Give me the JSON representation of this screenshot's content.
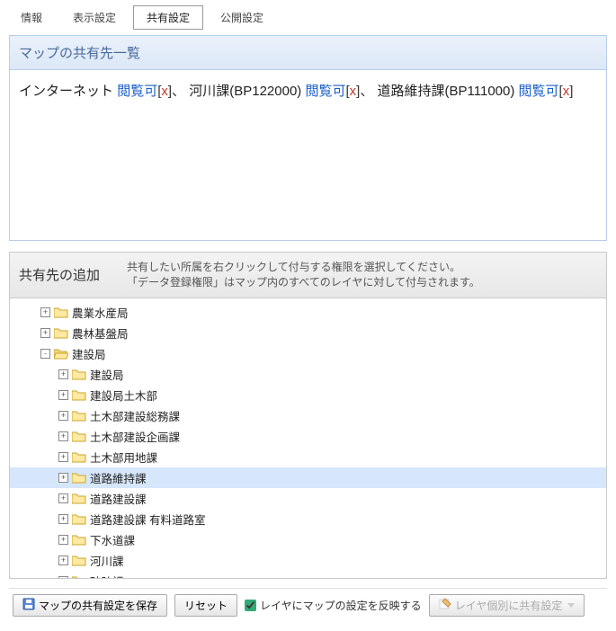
{
  "tabs": [
    {
      "label": "情報"
    },
    {
      "label": "表示設定"
    },
    {
      "label": "共有設定"
    },
    {
      "label": "公開設定"
    }
  ],
  "active_tab": 2,
  "share_list_header": "マップの共有先一覧",
  "shares": [
    {
      "name": "インターネット",
      "perm": "閲覧可",
      "sep": "、"
    },
    {
      "name": "河川課(BP122000)",
      "perm": "閲覧可",
      "sep": "、"
    },
    {
      "name": "道路維持課(BP111000)",
      "perm": "閲覧可",
      "sep": ""
    }
  ],
  "remove_glyph": "x",
  "add_header": "共有先の追加",
  "add_hint_1": "共有したい所属を右クリックして付与する権限を選択してください。",
  "add_hint_2": "「データ登録権限」はマップ内のすべてのレイヤに対して付与されます。",
  "tree": [
    {
      "label": "農業水産局",
      "depth": 1,
      "toggle": "+",
      "open": false,
      "selected": false
    },
    {
      "label": "農林基盤局",
      "depth": 1,
      "toggle": "+",
      "open": false,
      "selected": false
    },
    {
      "label": "建設局",
      "depth": 1,
      "toggle": "-",
      "open": true,
      "selected": false
    },
    {
      "label": "建設局",
      "depth": 2,
      "toggle": "+",
      "open": false,
      "selected": false
    },
    {
      "label": "建設局土木部",
      "depth": 2,
      "toggle": "+",
      "open": false,
      "selected": false
    },
    {
      "label": "土木部建設総務課",
      "depth": 2,
      "toggle": "+",
      "open": false,
      "selected": false
    },
    {
      "label": "土木部建設企画課",
      "depth": 2,
      "toggle": "+",
      "open": false,
      "selected": false
    },
    {
      "label": "土木部用地課",
      "depth": 2,
      "toggle": "+",
      "open": false,
      "selected": false
    },
    {
      "label": "道路維持課",
      "depth": 2,
      "toggle": "+",
      "open": false,
      "selected": true
    },
    {
      "label": "道路建設課",
      "depth": 2,
      "toggle": "+",
      "open": false,
      "selected": false
    },
    {
      "label": "道路建設課 有料道路室",
      "depth": 2,
      "toggle": "+",
      "open": false,
      "selected": false
    },
    {
      "label": "下水道課",
      "depth": 2,
      "toggle": "+",
      "open": false,
      "selected": false
    },
    {
      "label": "河川課",
      "depth": 2,
      "toggle": "+",
      "open": false,
      "selected": false
    },
    {
      "label": "砂防課",
      "depth": 2,
      "toggle": "+",
      "open": false,
      "selected": false
    }
  ],
  "footer": {
    "save_label": "マップの共有設定を保存",
    "reset_label": "リセット",
    "reflect_label": "レイヤにマップの設定を反映する",
    "per_layer_label": "レイヤ個別に共有設定"
  }
}
